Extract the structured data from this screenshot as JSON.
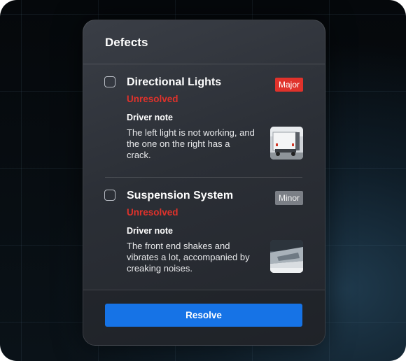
{
  "panel": {
    "title": "Defects"
  },
  "defects": [
    {
      "name": "Directional Lights",
      "status": "Unresolved",
      "severity": "Major",
      "note_label": "Driver note",
      "note_text": "The left light is not working, and the one on the right has a crack.",
      "thumbnail_icon": "truck-rear-photo"
    },
    {
      "name": "Suspension  System",
      "status": "Unresolved",
      "severity": "Minor",
      "note_label": "Driver note",
      "note_text": "The front end shakes and vibrates a lot, accompanied by creaking noises.",
      "thumbnail_icon": "vehicle-photo"
    }
  ],
  "actions": {
    "resolve_label": "Resolve"
  },
  "colors": {
    "unresolved": "#e0322b",
    "major_badge": "#e0322b",
    "minor_badge": "#7b7f86",
    "primary_button": "#1673e6"
  }
}
